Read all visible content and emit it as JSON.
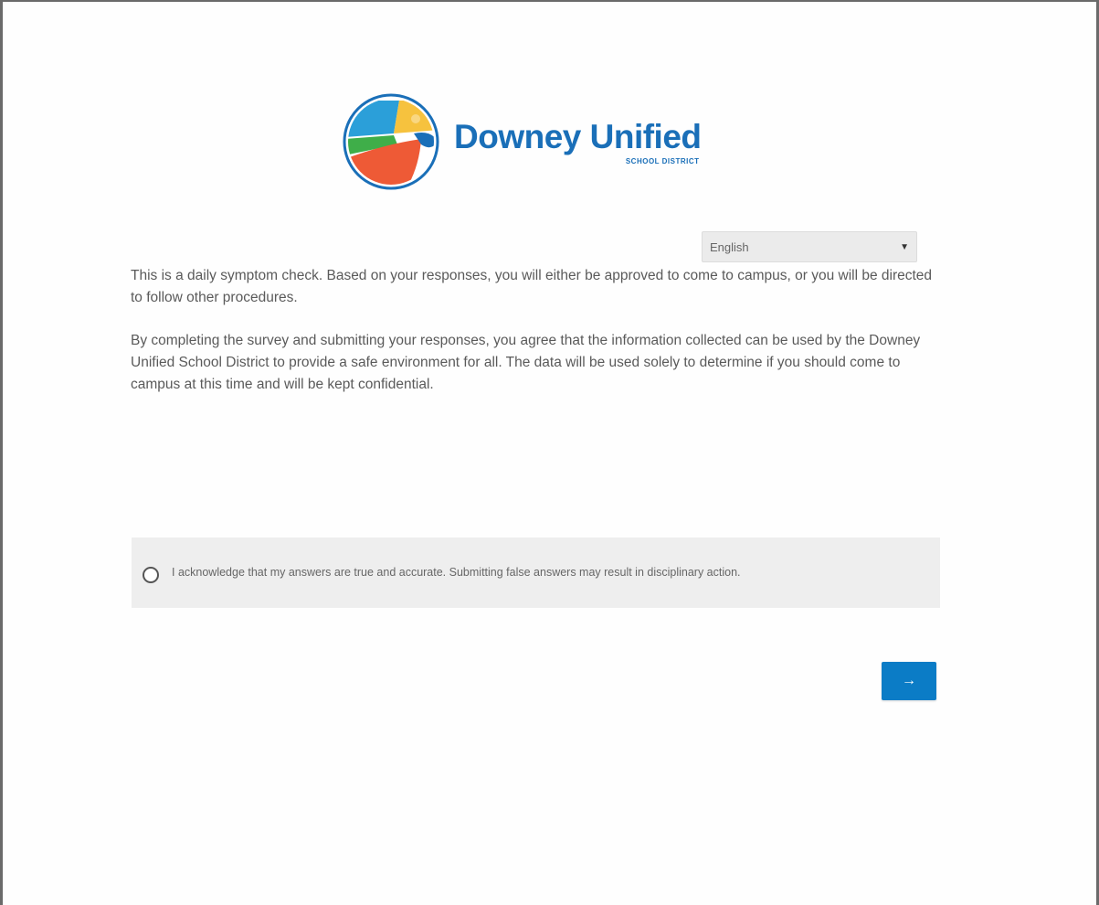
{
  "colors": {
    "brand_blue": "#1a6fb8",
    "button_blue": "#0b7cc6",
    "logo_yellow": "#f6c23e",
    "logo_green": "#3fae49",
    "logo_orange": "#ee5a36",
    "logo_lightblue": "#2b9fd9"
  },
  "logo": {
    "name": "Downey Unified",
    "subtitle": "SCHOOL DISTRICT",
    "icon": "district-seal-icon"
  },
  "language": {
    "selected": "English",
    "icon": "chevron-down-icon"
  },
  "intro": {
    "paragraph_1": "This is a daily symptom check. Based on your responses, you will either be approved to come to campus, or you will be directed to follow other procedures.",
    "paragraph_2": "By completing the survey and submitting your responses, you agree that the information collected can be used by the Downey Unified School District to provide a safe environment for all. The data will be used solely to determine if you should come to campus at this time and will be kept confidential."
  },
  "acknowledgement": {
    "label": "I acknowledge that my answers are true and accurate. Submitting false answers may result in disciplinary action.",
    "checked": false
  },
  "next_button": {
    "label": "→",
    "icon": "arrow-right-icon"
  }
}
